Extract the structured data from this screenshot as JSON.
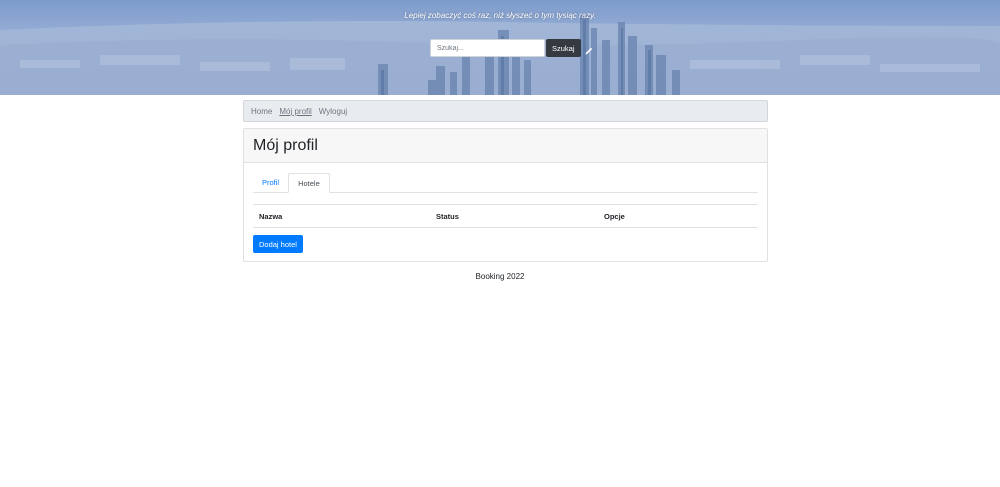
{
  "header": {
    "tagline": "Lepiej zobaczyć coś raz, niż słyszeć o tym tysiąc razy.",
    "search_placeholder": "Szukaj...",
    "search_button": "Szukaj",
    "edit_icon": "pencil-icon"
  },
  "breadcrumb": {
    "items": [
      "Home",
      "Mój profil",
      "Wyloguj"
    ]
  },
  "profile": {
    "title": "Mój profil",
    "tabs": [
      "Profil",
      "Hotele"
    ],
    "active_tab": "Hotele",
    "table_headers": [
      "Nazwa",
      "Status",
      "Opcje"
    ],
    "add_button": "Dodaj hotel"
  },
  "footer": {
    "text": "Booking 2022"
  },
  "colors": {
    "primary": "#007bff",
    "dark": "#343a40",
    "breadcrumb_bg": "#e9ecef",
    "card_header_bg": "#f7f7f7"
  }
}
